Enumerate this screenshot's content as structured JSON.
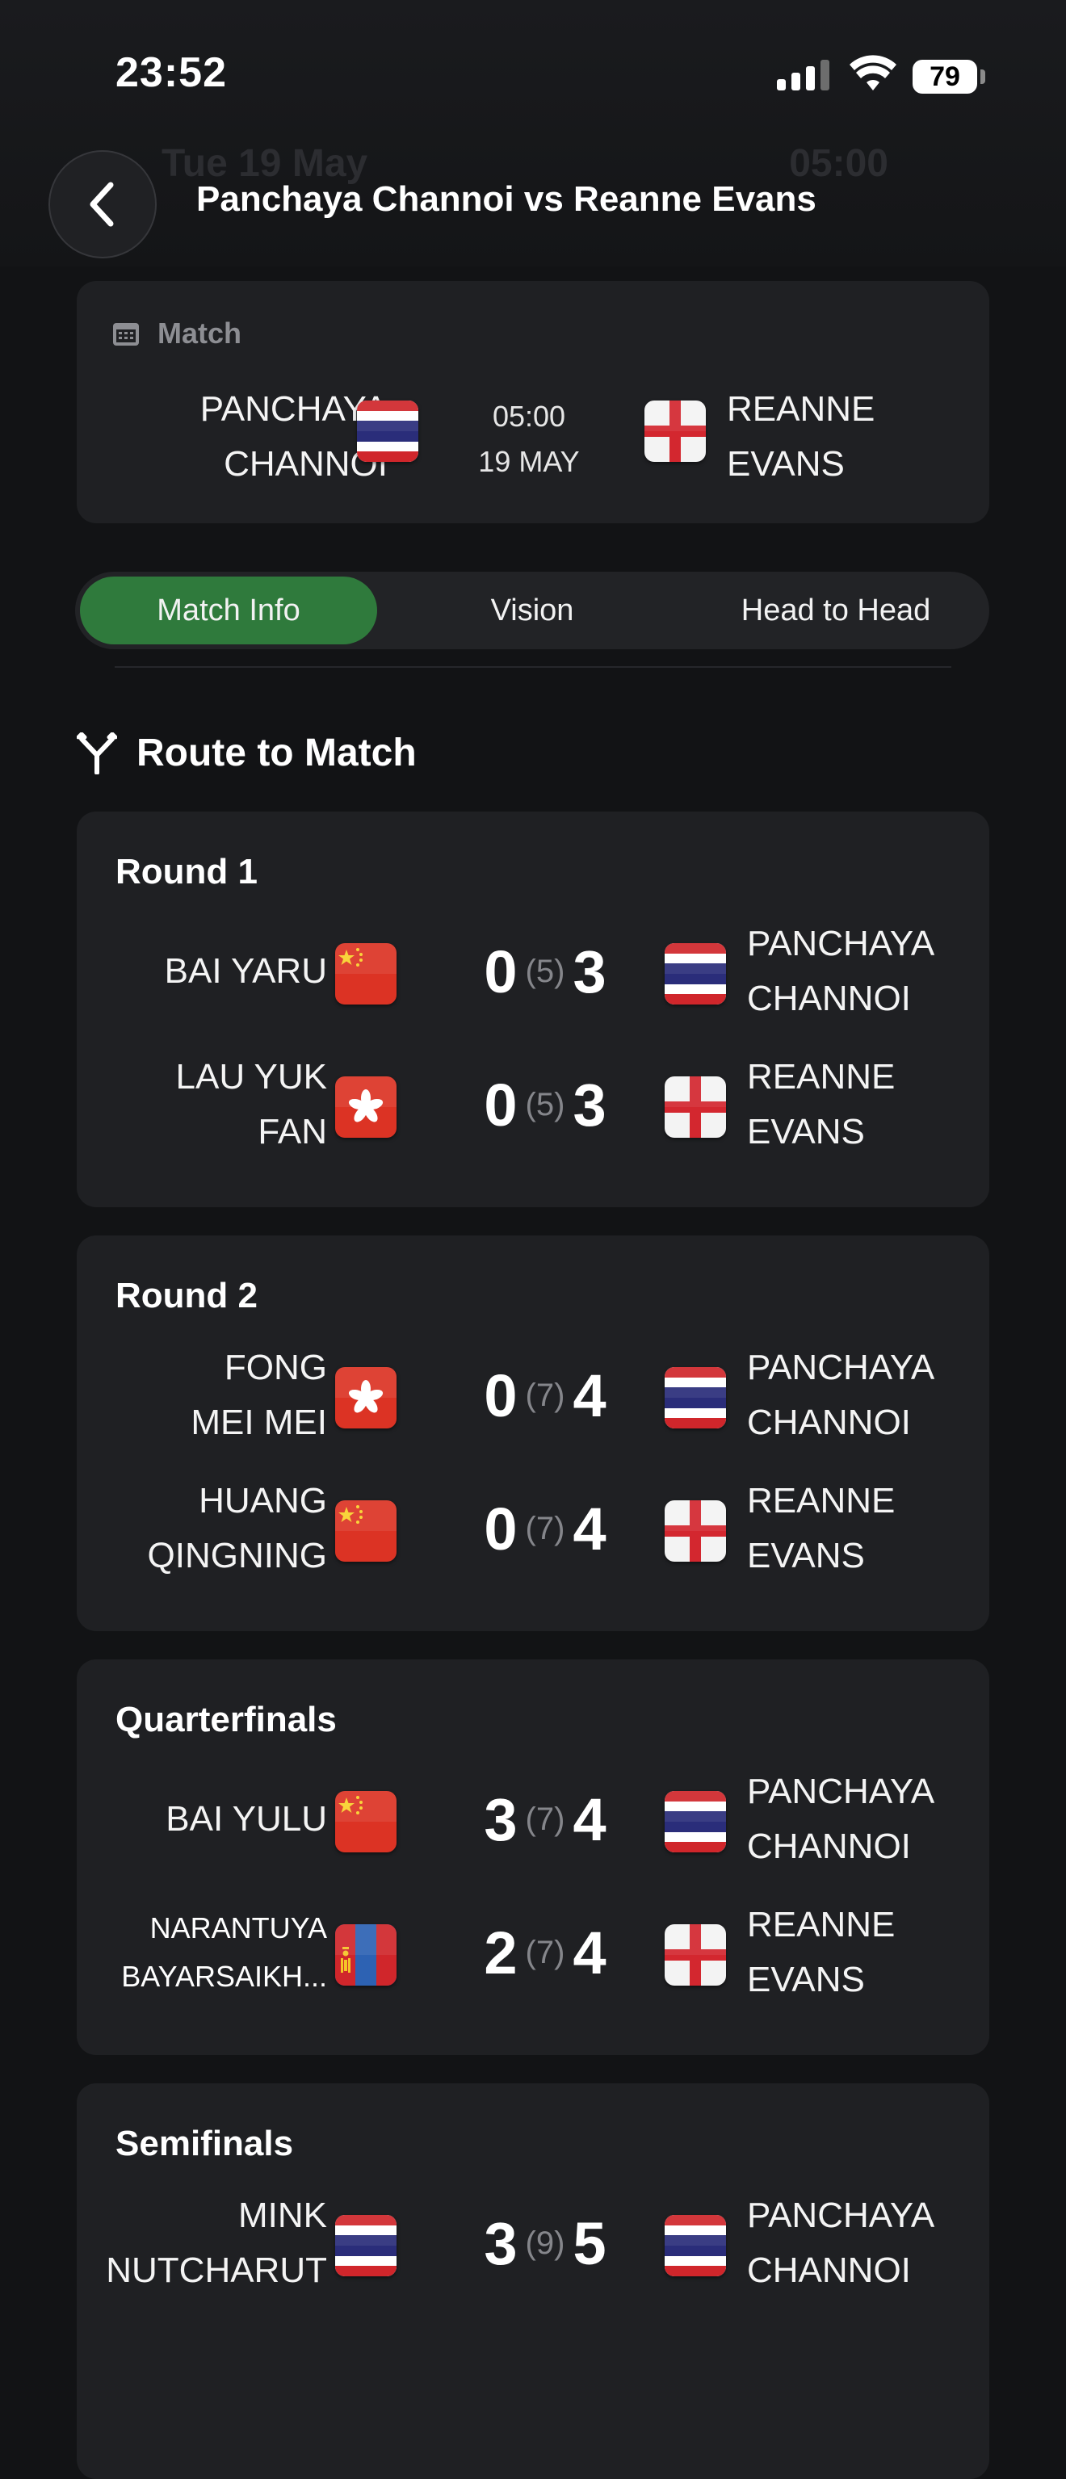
{
  "status_bar": {
    "time": "23:52",
    "battery": "79"
  },
  "background_bar": {
    "date": "Tue 19 May",
    "time": "05:00"
  },
  "header": {
    "title": "Panchaya Channoi vs Reanne Evans"
  },
  "match_card": {
    "label": "Match",
    "left_player": [
      "PANCHAYA",
      "CHANNOI"
    ],
    "left_flag": "thailand-flag",
    "time": "05:00",
    "date": "19 MAY",
    "right_player": [
      "REANNE",
      "EVANS"
    ],
    "right_flag": "england-flag"
  },
  "tabs": [
    {
      "label": "Match Info",
      "active": true
    },
    {
      "label": "Vision",
      "active": false
    },
    {
      "label": "Head to Head",
      "active": false
    }
  ],
  "section": {
    "title": "Route to Match",
    "icon": "route-split-icon"
  },
  "rounds": [
    {
      "title": "Round 1",
      "matches": [
        {
          "left": [
            "BAI YARU"
          ],
          "left_flag": "china-flag",
          "score_left": "0",
          "best_of": "(5)",
          "score_right": "3",
          "right": [
            "PANCHAYA",
            "CHANNOI"
          ],
          "right_flag": "thailand-flag"
        },
        {
          "left": [
            "LAU YUK",
            "FAN"
          ],
          "left_flag": "hong-kong-flag",
          "score_left": "0",
          "best_of": "(5)",
          "score_right": "3",
          "right": [
            "REANNE",
            "EVANS"
          ],
          "right_flag": "england-flag"
        }
      ]
    },
    {
      "title": "Round 2",
      "matches": [
        {
          "left": [
            "FONG",
            "MEI MEI"
          ],
          "left_flag": "hong-kong-flag",
          "score_left": "0",
          "best_of": "(7)",
          "score_right": "4",
          "right": [
            "PANCHAYA",
            "CHANNOI"
          ],
          "right_flag": "thailand-flag"
        },
        {
          "left": [
            "HUANG",
            "QINGNING"
          ],
          "left_flag": "china-flag",
          "score_left": "0",
          "best_of": "(7)",
          "score_right": "4",
          "right": [
            "REANNE",
            "EVANS"
          ],
          "right_flag": "england-flag"
        }
      ]
    },
    {
      "title": "Quarterfinals",
      "matches": [
        {
          "left": [
            "BAI YULU"
          ],
          "left_flag": "china-flag",
          "score_left": "3",
          "best_of": "(7)",
          "score_right": "4",
          "right": [
            "PANCHAYA",
            "CHANNOI"
          ],
          "right_flag": "thailand-flag"
        },
        {
          "left": [
            "NARANTUYA",
            "BAYARSAIKH..."
          ],
          "left_flag": "mongolia-flag",
          "score_left": "2",
          "best_of": "(7)",
          "score_right": "4",
          "right": [
            "REANNE",
            "EVANS"
          ],
          "right_flag": "england-flag",
          "small_left": true
        }
      ]
    },
    {
      "title": "Semifinals",
      "matches": [
        {
          "left": [
            "MINK",
            "NUTCHARUT"
          ],
          "left_flag": "thailand-flag",
          "score_left": "3",
          "best_of": "(9)",
          "score_right": "5",
          "right": [
            "PANCHAYA",
            "CHANNOI"
          ],
          "right_flag": "thailand-flag"
        }
      ]
    }
  ]
}
